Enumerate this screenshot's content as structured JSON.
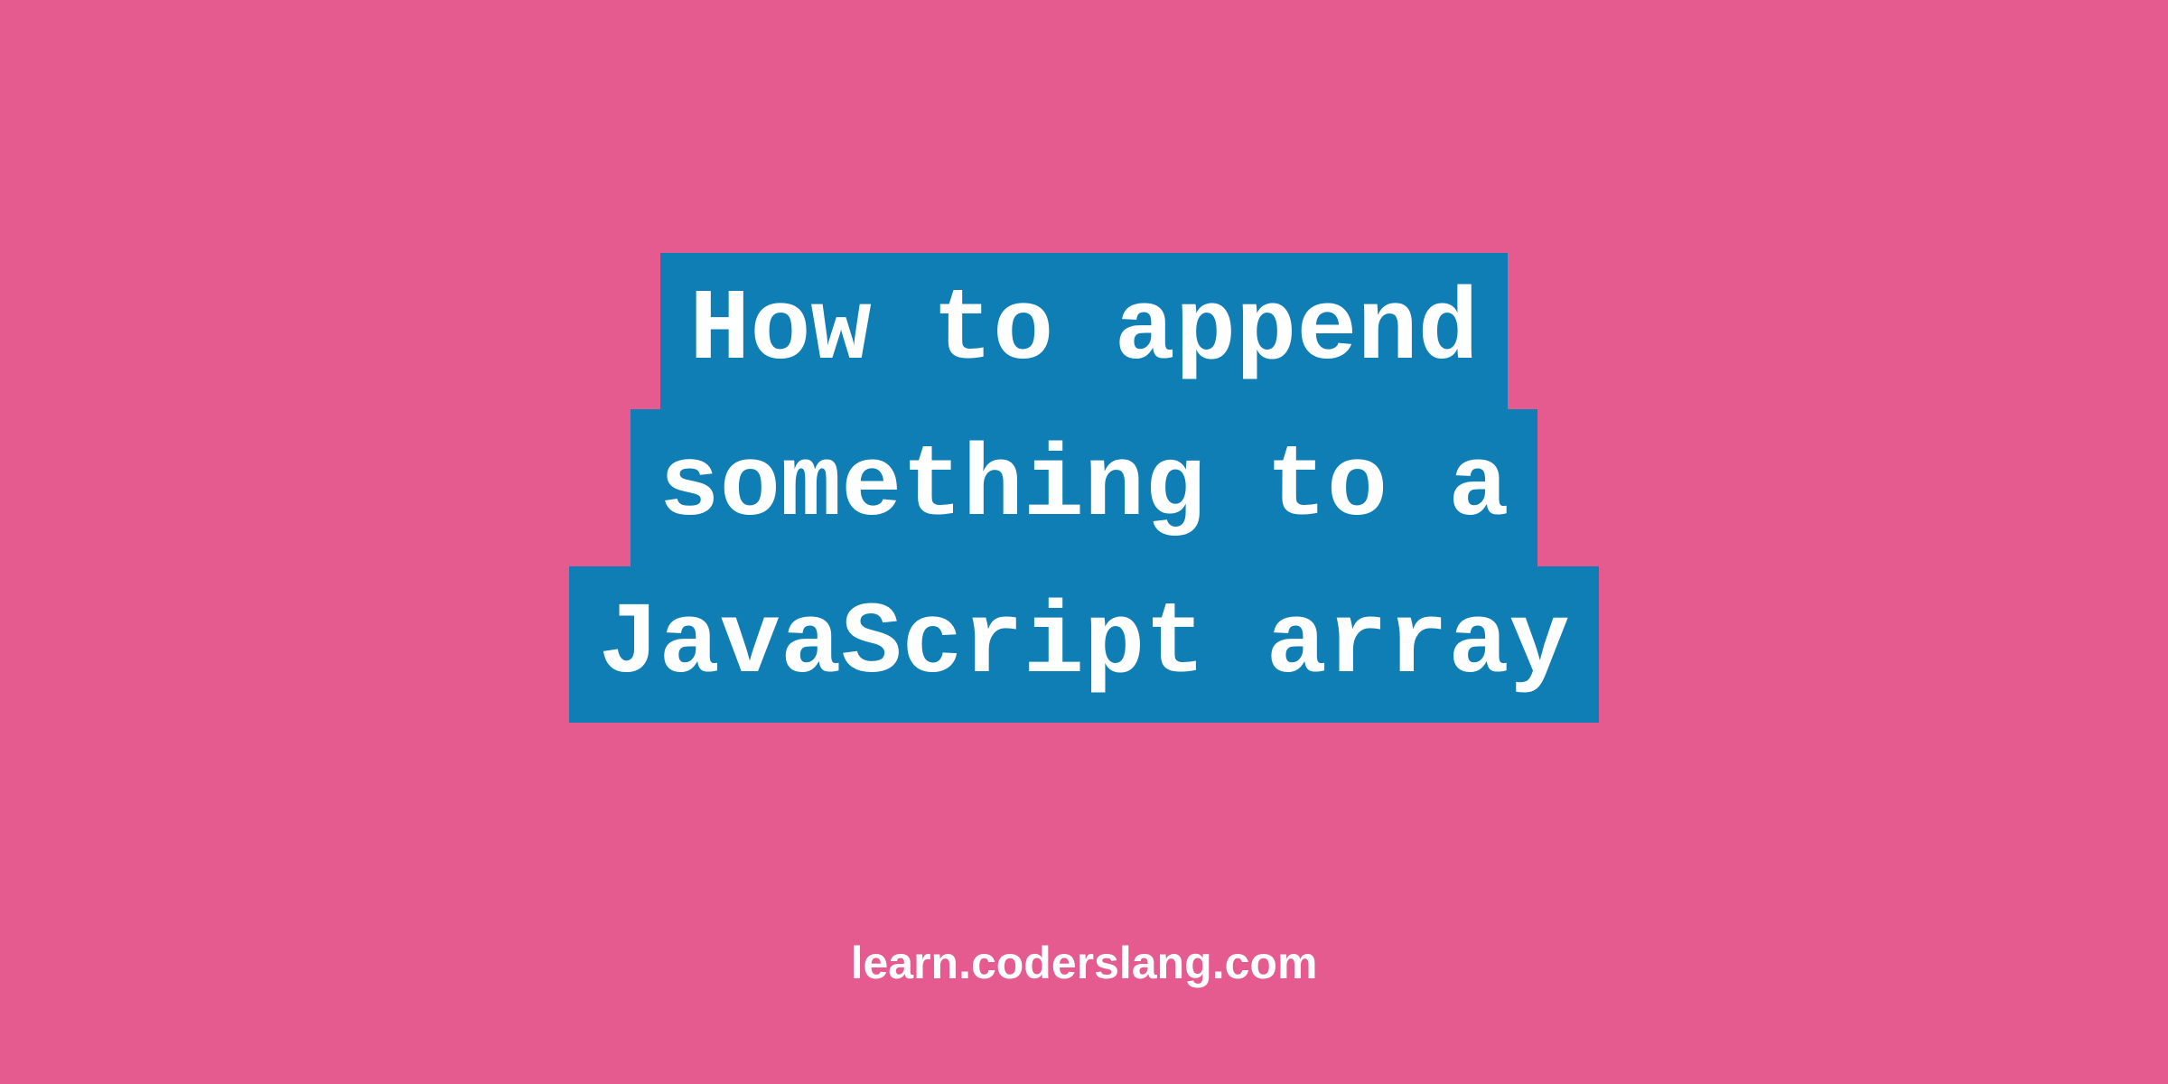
{
  "title": {
    "lines": [
      "How to append",
      "something to a",
      "JavaScript array"
    ]
  },
  "subtitle": "learn.coderslang.com",
  "colors": {
    "background": "#e55a8f",
    "titleBackground": "#0e7eb5",
    "text": "#ffffff"
  }
}
